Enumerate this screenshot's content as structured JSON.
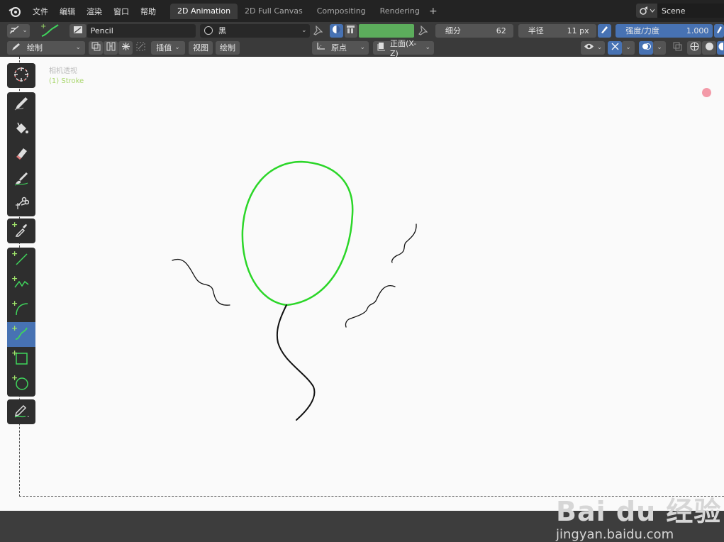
{
  "menu": {
    "file": "文件",
    "edit": "编辑",
    "render": "渲染",
    "window": "窗口",
    "help": "帮助"
  },
  "workspaces": [
    {
      "label": "2D Animation",
      "active": true
    },
    {
      "label": "2D Full Canvas",
      "active": false
    },
    {
      "label": "Compositing",
      "active": false
    },
    {
      "label": "Rendering",
      "active": false
    }
  ],
  "add_workspace": "+",
  "scene": {
    "name": "Scene"
  },
  "header": {
    "brush_name": "Pencil",
    "material": "黑",
    "vertex_color": "#5cad5c",
    "subdivide_label": "细分",
    "subdivide_value": "62",
    "radius_label": "半径",
    "radius_value": "11 px",
    "strength_label": "强度/力度",
    "strength_value": "1.000"
  },
  "header2": {
    "mode": "绘制",
    "interpolate": "插值",
    "view": "视图",
    "draw": "绘制",
    "origin": "原点",
    "orientation": "正面(X-Z)"
  },
  "viewport": {
    "camera_label": "相机透视",
    "object_label": "(1) Stroke",
    "stroke_color": "#2bd628"
  },
  "watermark": {
    "brand": "Bai du 经验",
    "url": "jingyan.baidu.com"
  }
}
